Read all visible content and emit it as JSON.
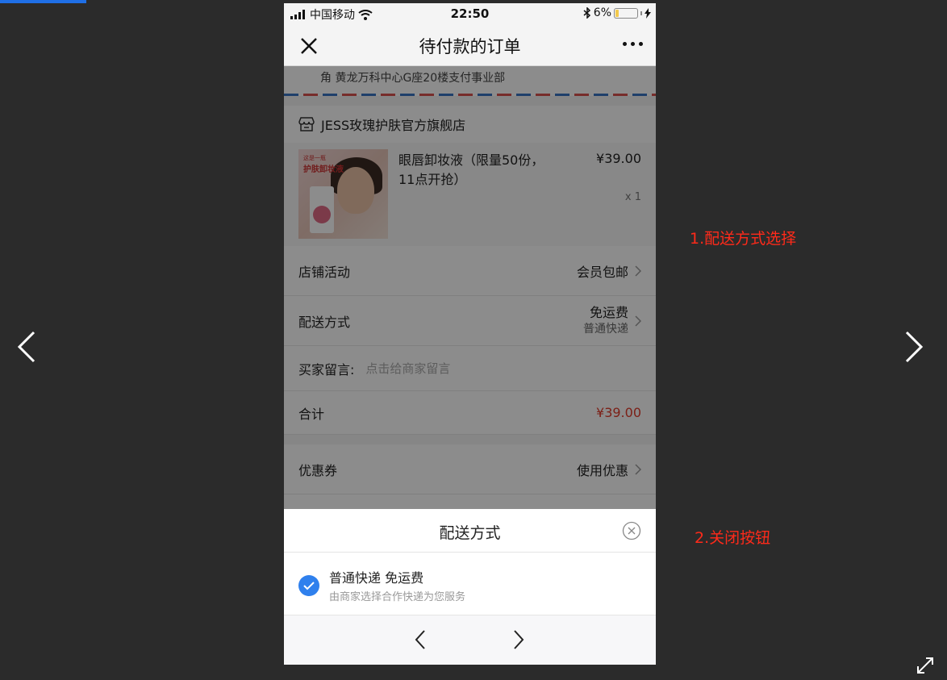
{
  "viewer": {
    "annotations": [
      "1.配送方式选择",
      "2.关闭按钮"
    ],
    "progress_fraction": 0.09
  },
  "status_bar": {
    "carrier": "中国移动",
    "time": "22:50",
    "battery": "6%",
    "battery_level": 0.06
  },
  "title_bar": {
    "title": "待付款的订单"
  },
  "address": {
    "text": "角 黄龙万科中心G座20楼支付事业部"
  },
  "shop": {
    "name": "JESS玫瑰护肤官方旗舰店"
  },
  "product": {
    "title": "眼唇卸妆液（限量50份，11点开抢）",
    "price": "¥39.00",
    "quantity": "x 1",
    "image_text_1": "这是一瓶",
    "image_text_2": "护肤卸妆液"
  },
  "rows": {
    "store_activity_label": "店铺活动",
    "store_activity_value": "会员包邮",
    "delivery_label": "配送方式",
    "delivery_value": "免运费",
    "delivery_sub": "普通快递",
    "message_label": "买家留言:",
    "message_placeholder": "点击给商家留言",
    "total_label": "合计",
    "total_value": "¥39.00",
    "coupon_label": "优惠券",
    "coupon_value": "使用优惠"
  },
  "sheet": {
    "title": "配送方式",
    "option_title": "普通快递 免运费",
    "option_sub": "由商家选择合作快递为您服务"
  },
  "colors": {
    "accent": "#2f80ed",
    "annotation": "#ff2a1a",
    "price_red": "#e23b2a"
  }
}
